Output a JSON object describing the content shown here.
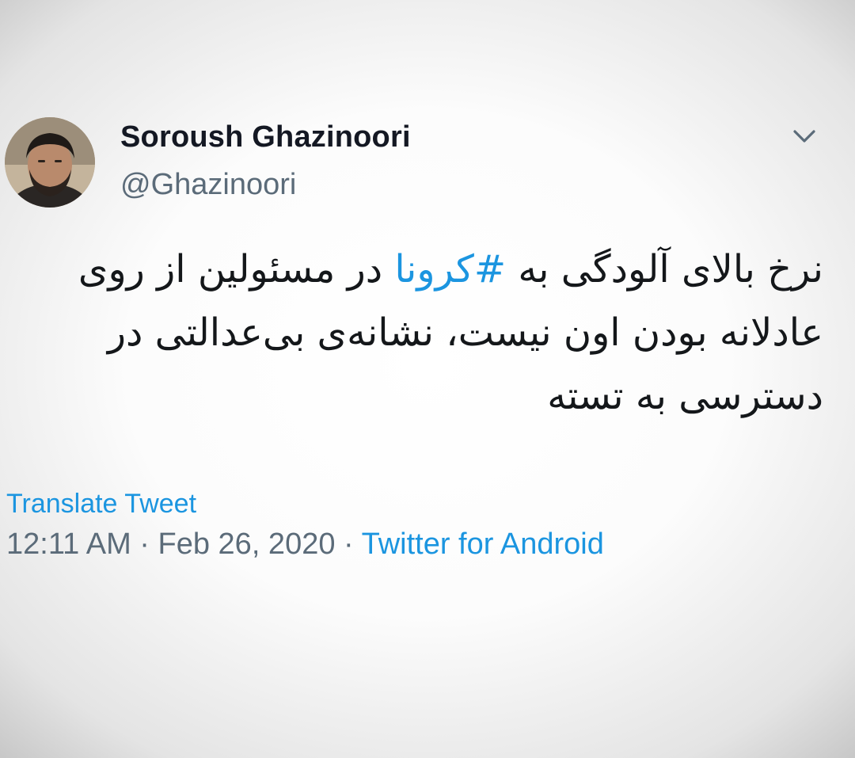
{
  "tweet": {
    "author": {
      "display_name": "Soroush Ghazinoori",
      "handle": "@Ghazinoori"
    },
    "menu_icon": "chevron-down-icon",
    "text": {
      "before_hashtag": "نرخ بالای آلودگی به ",
      "hashtag": "#کرونا",
      "after_hashtag": " در مسئولین از روی عادلانه بودن اون نیست، نشانه‌ی بی‌عدالتی در دسترسی به تسته"
    },
    "translate_label": "Translate Tweet",
    "time": "12:11 AM",
    "date": "Feb 26, 2020",
    "separator": "·",
    "source": "Twitter for Android"
  },
  "colors": {
    "link": "#1b95e0",
    "name": "#141823",
    "secondary": "#5b6b79"
  }
}
